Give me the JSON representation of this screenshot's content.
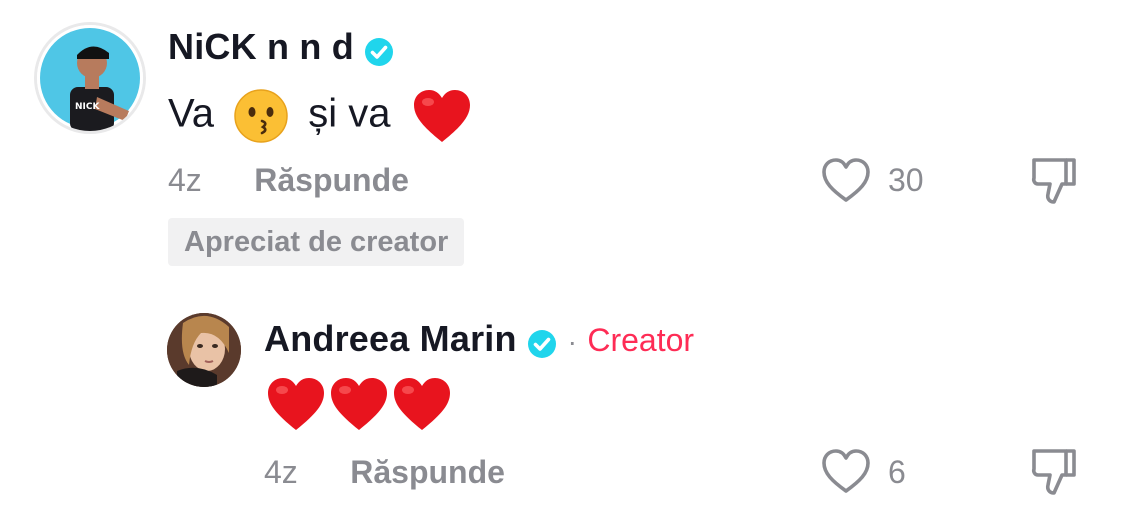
{
  "comment": {
    "username": "NiCK n n d",
    "text_parts": [
      "Va",
      "și va"
    ],
    "emojis": [
      "kissing-face-emoji",
      "red-heart-emoji"
    ],
    "time": "4z",
    "reply_label": "Răspunde",
    "like_count": "30",
    "liked_by_creator": "Apreciat de creator"
  },
  "reply": {
    "username": "Andreea Marin",
    "separator": "·",
    "creator_label": "Creator",
    "emojis": [
      "red-heart-emoji",
      "red-heart-emoji",
      "red-heart-emoji"
    ],
    "time": "4z",
    "reply_label": "Răspunde",
    "like_count": "6"
  },
  "colors": {
    "verified": "#20d5ec",
    "creator": "#fe2c55",
    "muted": "#8a8b91",
    "heart": "#e8141e"
  }
}
